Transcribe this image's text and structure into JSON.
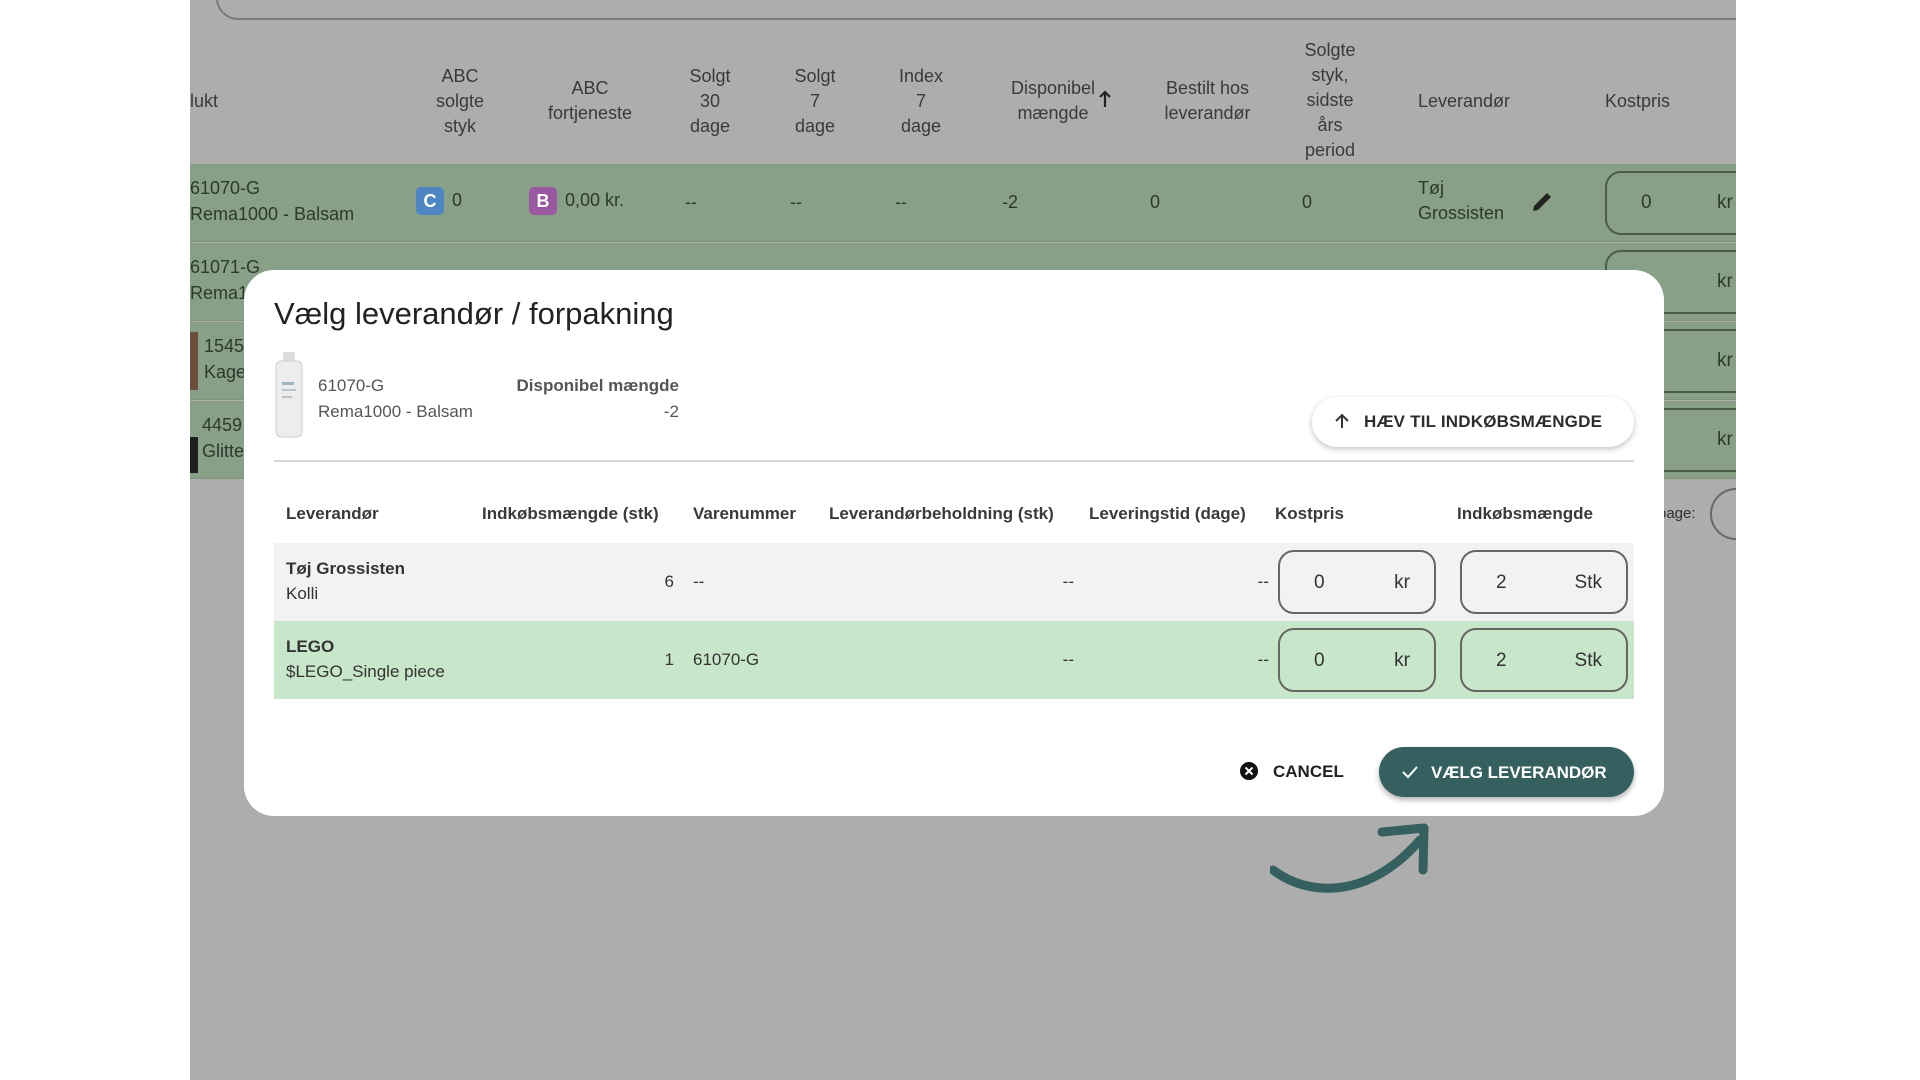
{
  "background_table": {
    "headers": {
      "produkt": "lukt",
      "abc_solgte": [
        "ABC",
        "solgte",
        "styk"
      ],
      "abc_fortjeneste": [
        "ABC",
        "fortjeneste"
      ],
      "solgt30": [
        "Solgt",
        "30",
        "dage"
      ],
      "solgt7": [
        "Solgt",
        "7",
        "dage"
      ],
      "index7": [
        "Index",
        "7",
        "dage"
      ],
      "disponibel": [
        "Disponibel",
        "mængde"
      ],
      "bestilt": [
        "Bestilt hos",
        "leverandør"
      ],
      "solgte_aar": [
        "Solgte",
        "styk,",
        "sidste",
        "års",
        "period"
      ],
      "leverandor": "Leverandør",
      "kostpris": "Kostpris"
    },
    "row1": {
      "sku": "61070-G",
      "name": "Rema1000 - Balsam",
      "abc_solgte_badge": "C",
      "abc_solgte_value": "0",
      "abc_fortjeneste_badge": "B",
      "abc_fortjeneste_value": "0,00 kr.",
      "solgt30": "--",
      "solgt7": "--",
      "index7": "--",
      "disponibel": "-2",
      "bestilt": "0",
      "solgte_aar": "0",
      "leverandor": [
        "Tøj",
        "Grossisten"
      ],
      "kostpris_value": "0",
      "kostpris_unit": "kr"
    },
    "row2": {
      "sku": "61071-G",
      "name": "Rema1",
      "kostpris_unit": "kr"
    },
    "row3": {
      "sku": "1545",
      "name": "Kage",
      "kostpris_unit": "kr"
    },
    "row4": {
      "sku": "4459",
      "name": "Glitte",
      "kostpris_unit": "kr"
    },
    "pagination_fragment": "page:"
  },
  "modal": {
    "title": "Vælg leverandør / forpakning",
    "product": {
      "sku": "61070-G",
      "name": "Rema1000 - Balsam",
      "disponibel_label": "Disponibel mængde",
      "disponibel_value": "-2"
    },
    "raise_button": "HÆV TIL INDKØBSMÆNGDE",
    "columns": {
      "leverandor": "Leverandør",
      "indkobsmaengde_stk": "Indkøbsmængde (stk)",
      "varenummer": "Varenummer",
      "beholdning": "Leverandørbeholdning (stk)",
      "leveringstid": "Leveringstid (dage)",
      "kostpris": "Kostpris",
      "indkobsmaengde": "Indkøbsmængde"
    },
    "rows": [
      {
        "leverandor": "Tøj Grossisten",
        "pakning": "Kolli",
        "indkobsmaengde_stk": "6",
        "varenummer": "--",
        "beholdning": "--",
        "leveringstid": "--",
        "kostpris": "0",
        "kostpris_unit": "kr",
        "antal": "2",
        "antal_unit": "Stk"
      },
      {
        "leverandor": "LEGO",
        "pakning": "$LEGO_Single piece",
        "indkobsmaengde_stk": "1",
        "varenummer": "61070-G",
        "beholdning": "--",
        "leveringstid": "--",
        "kostpris": "0",
        "kostpris_unit": "kr",
        "antal": "2",
        "antal_unit": "Stk"
      }
    ],
    "cancel_button": "CANCEL",
    "confirm_button": "VÆLG LEVERANDØR"
  },
  "colors": {
    "selected_row": "#c8e6c9",
    "confirm_button": "#35605f",
    "overlay": "#adadad",
    "badge_c": "#4e86c4",
    "badge_b": "#9a58a0"
  },
  "icons": [
    "arrow-up-icon",
    "check-icon",
    "cancel-circle-icon",
    "pencil-icon",
    "sort-arrow-up-icon",
    "curved-arrow-icon"
  ]
}
